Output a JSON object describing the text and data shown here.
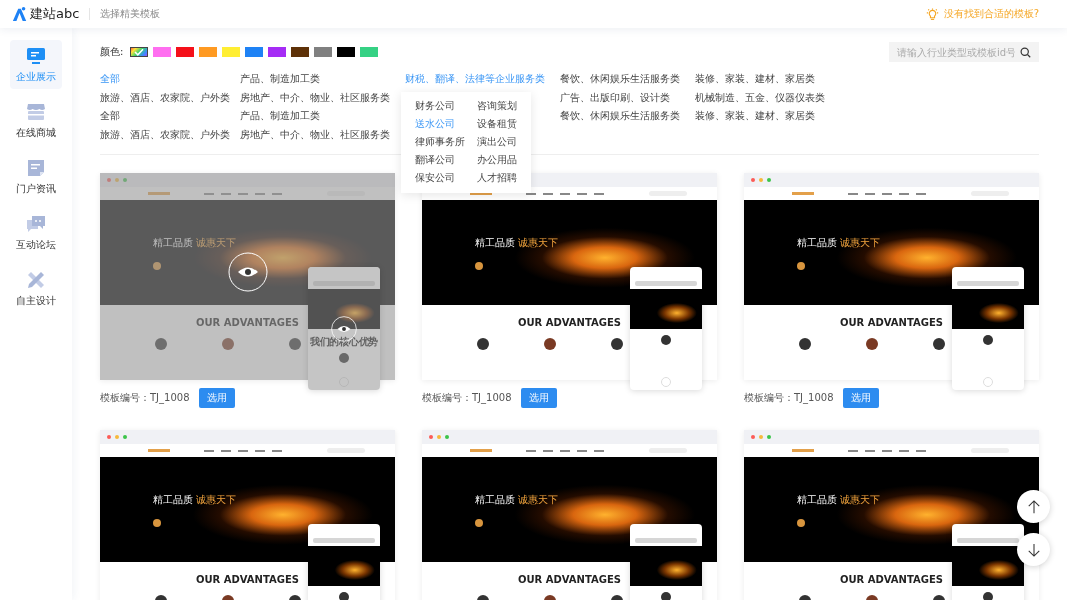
{
  "header": {
    "logo_text": "建站abc",
    "subtitle": "选择精美模板",
    "help_link": "没有找到合适的模板?"
  },
  "sidebar": {
    "items": [
      {
        "kind": "display",
        "label": "企业展示",
        "selected": true
      },
      {
        "kind": "shop",
        "label": "在线商城",
        "selected": false
      },
      {
        "kind": "news",
        "label": "门户资讯",
        "selected": false
      },
      {
        "kind": "forum",
        "label": "互动论坛",
        "selected": false
      },
      {
        "kind": "design",
        "label": "自主设计",
        "selected": false
      }
    ]
  },
  "colors": {
    "label": "颜色:",
    "swatches": [
      {
        "kind": "rainbow",
        "selected": true
      },
      {
        "kind": "solid",
        "color": "#ff6ef0",
        "selected": false
      },
      {
        "kind": "solid",
        "color": "#f5101a",
        "selected": false
      },
      {
        "kind": "solid",
        "color": "#ff9a22",
        "selected": false
      },
      {
        "kind": "solid",
        "color": "#ffee33",
        "selected": false
      },
      {
        "kind": "solid",
        "color": "#1e82f5",
        "selected": false
      },
      {
        "kind": "solid",
        "color": "#a52cf5",
        "selected": false
      },
      {
        "kind": "solid",
        "color": "#5e3108",
        "selected": false
      },
      {
        "kind": "solid",
        "color": "#808080",
        "selected": false
      },
      {
        "kind": "solid",
        "color": "#000000",
        "selected": false
      },
      {
        "kind": "solid",
        "color": "#35d184",
        "selected": false
      }
    ]
  },
  "search": {
    "placeholder": "请输入行业类型或模板id号"
  },
  "category_columns": [
    {
      "items": [
        {
          "label": "全部",
          "selected": true
        },
        {
          "label": "旅游、酒店、农家院、户外类",
          "selected": false
        },
        {
          "label": "全部",
          "selected": false
        },
        {
          "label": "旅游、酒店、农家院、户外类",
          "selected": false
        }
      ]
    },
    {
      "items": [
        {
          "label": "产品、制造加工类",
          "selected": false
        },
        {
          "label": "房地产、中介、物业、社区服务类",
          "selected": false
        },
        {
          "label": "产品、制造加工类",
          "selected": false
        },
        {
          "label": "房地产、中介、物业、社区服务类",
          "selected": false
        }
      ]
    },
    {
      "items": [
        {
          "label": "财税、翻译、法律等企业服务类",
          "selected": true,
          "expanded": true,
          "submenu": [
            {
              "label": "财务公司",
              "selected": false
            },
            {
              "label": "咨询策划",
              "selected": false
            },
            {
              "label": "送水公司",
              "selected": true
            },
            {
              "label": "设备租赁",
              "selected": false
            },
            {
              "label": "律师事务所",
              "selected": false
            },
            {
              "label": "演出公司",
              "selected": false
            },
            {
              "label": "翻译公司",
              "selected": false
            },
            {
              "label": "办公用品",
              "selected": false
            },
            {
              "label": "保安公司",
              "selected": false
            },
            {
              "label": "人才招聘",
              "selected": false
            }
          ]
        }
      ]
    },
    {
      "items": [
        {
          "label": "餐饮、休闲娱乐生活服务类",
          "selected": false
        },
        {
          "label": "广告、出版印刷、设计类",
          "selected": false
        },
        {
          "label": "餐饮、休闲娱乐生活服务类",
          "selected": false
        }
      ]
    },
    {
      "items": [
        {
          "label": "装修、家装、建材、家居类",
          "selected": false
        },
        {
          "label": "机械制造、五金、仪器仪表类",
          "selected": false
        },
        {
          "label": "装修、家装、建材、家居类",
          "selected": false
        }
      ]
    }
  ],
  "templates": [
    {
      "hovered": true,
      "hero_title": "精工品质",
      "hero_accent": "诚惠天下",
      "section_title": "OUR ADVANTAGES",
      "mobile_caption": "我们的核心优势",
      "code": "模板编号：TJ_1008",
      "button": "选用"
    },
    {
      "hovered": false,
      "hero_title": "精工品质",
      "hero_accent": "诚惠天下",
      "section_title": "OUR ADVANTAGES",
      "code": "模板编号：TJ_1008",
      "button": "选用"
    },
    {
      "hovered": false,
      "hero_title": "精工品质",
      "hero_accent": "诚惠天下",
      "section_title": "OUR ADVANTAGES",
      "code": "模板编号：TJ_1008",
      "button": "选用"
    },
    {
      "hovered": false,
      "hero_title": "精工品质",
      "hero_accent": "诚惠天下",
      "section_title": "OUR ADVANTAGES"
    },
    {
      "hovered": false,
      "hero_title": "精工品质",
      "hero_accent": "诚惠天下",
      "section_title": "OUR ADVANTAGES"
    },
    {
      "hovered": false,
      "hero_title": "精工品质",
      "hero_accent": "诚惠天下",
      "section_title": "OUR ADVANTAGES"
    }
  ]
}
